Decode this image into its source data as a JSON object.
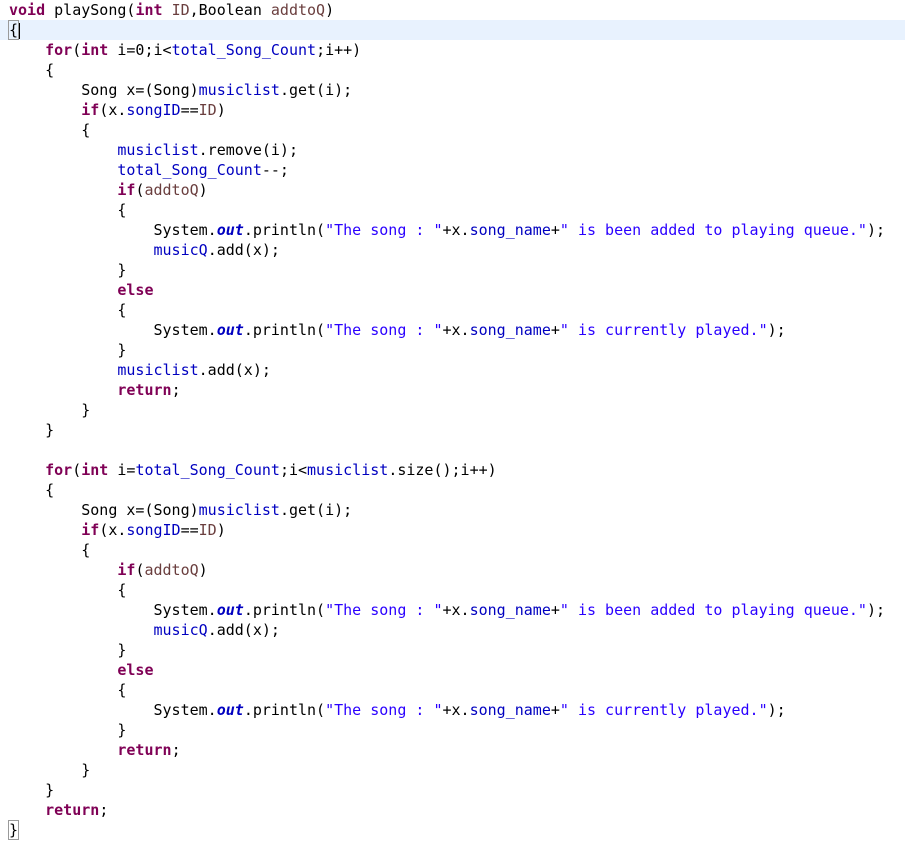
{
  "editor": {
    "background": "#ffffff",
    "current_line_color": "#e8f2fe",
    "token_colors": {
      "keyword": "#7f0055",
      "field": "#0000c0",
      "string": "#2a00ff",
      "parameter": "#6a3e3e",
      "plain": "#000000"
    },
    "lines": [
      [
        [
          "keyword",
          "void"
        ],
        [
          "plain",
          " playSong("
        ],
        [
          "keyword",
          "int"
        ],
        [
          "plain",
          " "
        ],
        [
          "param",
          "ID"
        ],
        [
          "plain",
          ",Boolean "
        ],
        [
          "param",
          "addtoQ"
        ],
        [
          "plain",
          ")"
        ]
      ],
      [
        [
          "plain",
          "{"
        ]
      ],
      [
        [
          "plain",
          "    "
        ],
        [
          "keyword",
          "for"
        ],
        [
          "plain",
          "("
        ],
        [
          "keyword",
          "int"
        ],
        [
          "plain",
          " i=0;i<"
        ],
        [
          "field",
          "total_Song_Count"
        ],
        [
          "plain",
          ";i++)"
        ]
      ],
      [
        [
          "plain",
          "    {"
        ]
      ],
      [
        [
          "plain",
          "        Song x=(Song)"
        ],
        [
          "field",
          "musiclist"
        ],
        [
          "plain",
          ".get(i);"
        ]
      ],
      [
        [
          "plain",
          "        "
        ],
        [
          "keyword",
          "if"
        ],
        [
          "plain",
          "(x."
        ],
        [
          "field",
          "songID"
        ],
        [
          "plain",
          "=="
        ],
        [
          "param",
          "ID"
        ],
        [
          "plain",
          ")"
        ]
      ],
      [
        [
          "plain",
          "        {"
        ]
      ],
      [
        [
          "plain",
          "            "
        ],
        [
          "field",
          "musiclist"
        ],
        [
          "plain",
          ".remove(i);"
        ]
      ],
      [
        [
          "plain",
          "            "
        ],
        [
          "field",
          "total_Song_Count"
        ],
        [
          "plain",
          "--;"
        ]
      ],
      [
        [
          "plain",
          "            "
        ],
        [
          "keyword",
          "if"
        ],
        [
          "plain",
          "("
        ],
        [
          "param",
          "addtoQ"
        ],
        [
          "plain",
          ")"
        ]
      ],
      [
        [
          "plain",
          "            {"
        ]
      ],
      [
        [
          "plain",
          "                System."
        ],
        [
          "static",
          "out"
        ],
        [
          "plain",
          ".println("
        ],
        [
          "string",
          "\"The song : \""
        ],
        [
          "plain",
          "+x."
        ],
        [
          "field",
          "song_name"
        ],
        [
          "plain",
          "+"
        ],
        [
          "string",
          "\" is been added to playing queue.\""
        ],
        [
          "plain",
          ");"
        ]
      ],
      [
        [
          "plain",
          "                "
        ],
        [
          "field",
          "musicQ"
        ],
        [
          "plain",
          ".add(x);"
        ]
      ],
      [
        [
          "plain",
          "            }"
        ]
      ],
      [
        [
          "plain",
          "            "
        ],
        [
          "keyword",
          "else"
        ]
      ],
      [
        [
          "plain",
          "            {"
        ]
      ],
      [
        [
          "plain",
          "                System."
        ],
        [
          "static",
          "out"
        ],
        [
          "plain",
          ".println("
        ],
        [
          "string",
          "\"The song : \""
        ],
        [
          "plain",
          "+x."
        ],
        [
          "field",
          "song_name"
        ],
        [
          "plain",
          "+"
        ],
        [
          "string",
          "\" is currently played.\""
        ],
        [
          "plain",
          ");"
        ]
      ],
      [
        [
          "plain",
          "            }"
        ]
      ],
      [
        [
          "plain",
          "            "
        ],
        [
          "field",
          "musiclist"
        ],
        [
          "plain",
          ".add(x);"
        ]
      ],
      [
        [
          "plain",
          "            "
        ],
        [
          "keyword",
          "return"
        ],
        [
          "plain",
          ";"
        ]
      ],
      [
        [
          "plain",
          "        }"
        ]
      ],
      [
        [
          "plain",
          "    }"
        ]
      ],
      [
        [
          "plain",
          ""
        ]
      ],
      [
        [
          "plain",
          "    "
        ],
        [
          "keyword",
          "for"
        ],
        [
          "plain",
          "("
        ],
        [
          "keyword",
          "int"
        ],
        [
          "plain",
          " i="
        ],
        [
          "field",
          "total_Song_Count"
        ],
        [
          "plain",
          ";i<"
        ],
        [
          "field",
          "musiclist"
        ],
        [
          "plain",
          ".size();i++)"
        ]
      ],
      [
        [
          "plain",
          "    {"
        ]
      ],
      [
        [
          "plain",
          "        Song x=(Song)"
        ],
        [
          "field",
          "musiclist"
        ],
        [
          "plain",
          ".get(i);"
        ]
      ],
      [
        [
          "plain",
          "        "
        ],
        [
          "keyword",
          "if"
        ],
        [
          "plain",
          "(x."
        ],
        [
          "field",
          "songID"
        ],
        [
          "plain",
          "=="
        ],
        [
          "param",
          "ID"
        ],
        [
          "plain",
          ")"
        ]
      ],
      [
        [
          "plain",
          "        {"
        ]
      ],
      [
        [
          "plain",
          "            "
        ],
        [
          "keyword",
          "if"
        ],
        [
          "plain",
          "("
        ],
        [
          "param",
          "addtoQ"
        ],
        [
          "plain",
          ")"
        ]
      ],
      [
        [
          "plain",
          "            {"
        ]
      ],
      [
        [
          "plain",
          "                System."
        ],
        [
          "static",
          "out"
        ],
        [
          "plain",
          ".println("
        ],
        [
          "string",
          "\"The song : \""
        ],
        [
          "plain",
          "+x."
        ],
        [
          "field",
          "song_name"
        ],
        [
          "plain",
          "+"
        ],
        [
          "string",
          "\" is been added to playing queue.\""
        ],
        [
          "plain",
          ");"
        ]
      ],
      [
        [
          "plain",
          "                "
        ],
        [
          "field",
          "musicQ"
        ],
        [
          "plain",
          ".add(x);"
        ]
      ],
      [
        [
          "plain",
          "            }"
        ]
      ],
      [
        [
          "plain",
          "            "
        ],
        [
          "keyword",
          "else"
        ]
      ],
      [
        [
          "plain",
          "            {"
        ]
      ],
      [
        [
          "plain",
          "                System."
        ],
        [
          "static",
          "out"
        ],
        [
          "plain",
          ".println("
        ],
        [
          "string",
          "\"The song : \""
        ],
        [
          "plain",
          "+x."
        ],
        [
          "field",
          "song_name"
        ],
        [
          "plain",
          "+"
        ],
        [
          "string",
          "\" is currently played.\""
        ],
        [
          "plain",
          ");"
        ]
      ],
      [
        [
          "plain",
          "            }"
        ]
      ],
      [
        [
          "plain",
          "            "
        ],
        [
          "keyword",
          "return"
        ],
        [
          "plain",
          ";"
        ]
      ],
      [
        [
          "plain",
          "        }"
        ]
      ],
      [
        [
          "plain",
          "    }"
        ]
      ],
      [
        [
          "plain",
          "    "
        ],
        [
          "keyword",
          "return"
        ],
        [
          "plain",
          ";"
        ]
      ],
      [
        [
          "plain",
          "}"
        ]
      ]
    ]
  }
}
